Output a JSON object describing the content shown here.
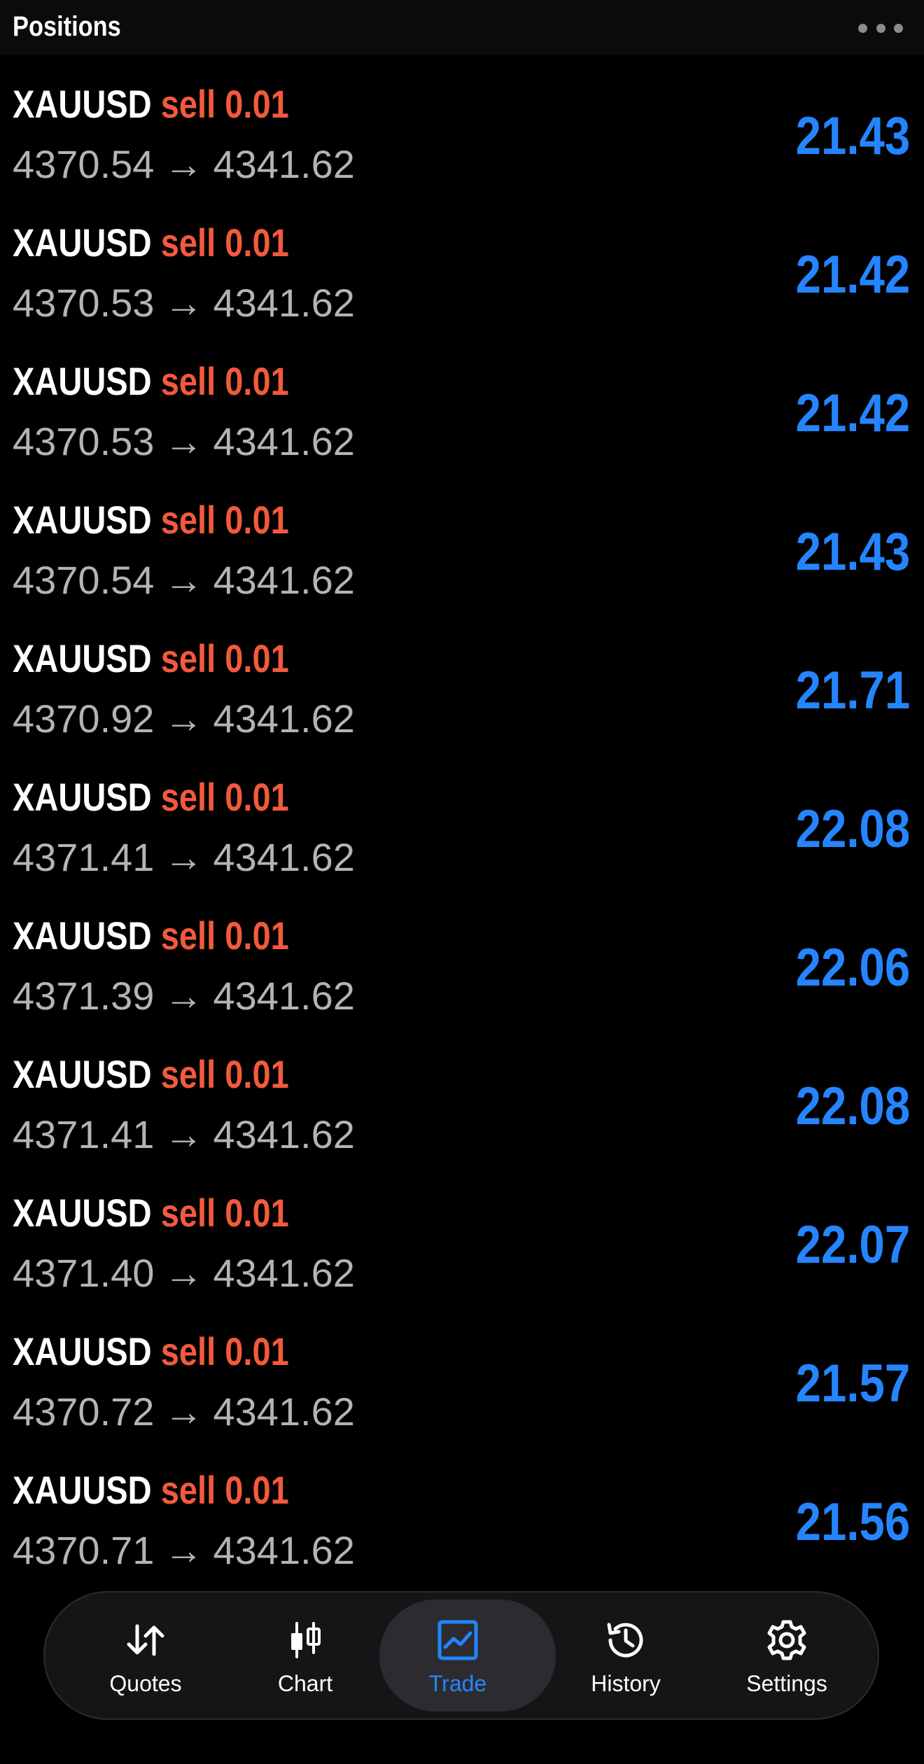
{
  "header": {
    "title": "Positions",
    "more_icon": "more-horizontal-icon"
  },
  "positions": [
    {
      "symbol": "XAUUSD",
      "side": "sell",
      "volume": "0.01",
      "open_price": "4370.54",
      "current_price": "4341.62",
      "profit": "21.43"
    },
    {
      "symbol": "XAUUSD",
      "side": "sell",
      "volume": "0.01",
      "open_price": "4370.53",
      "current_price": "4341.62",
      "profit": "21.42"
    },
    {
      "symbol": "XAUUSD",
      "side": "sell",
      "volume": "0.01",
      "open_price": "4370.53",
      "current_price": "4341.62",
      "profit": "21.42"
    },
    {
      "symbol": "XAUUSD",
      "side": "sell",
      "volume": "0.01",
      "open_price": "4370.54",
      "current_price": "4341.62",
      "profit": "21.43"
    },
    {
      "symbol": "XAUUSD",
      "side": "sell",
      "volume": "0.01",
      "open_price": "4370.92",
      "current_price": "4341.62",
      "profit": "21.71"
    },
    {
      "symbol": "XAUUSD",
      "side": "sell",
      "volume": "0.01",
      "open_price": "4371.41",
      "current_price": "4341.62",
      "profit": "22.08"
    },
    {
      "symbol": "XAUUSD",
      "side": "sell",
      "volume": "0.01",
      "open_price": "4371.39",
      "current_price": "4341.62",
      "profit": "22.06"
    },
    {
      "symbol": "XAUUSD",
      "side": "sell",
      "volume": "0.01",
      "open_price": "4371.41",
      "current_price": "4341.62",
      "profit": "22.08"
    },
    {
      "symbol": "XAUUSD",
      "side": "sell",
      "volume": "0.01",
      "open_price": "4371.40",
      "current_price": "4341.62",
      "profit": "22.07"
    },
    {
      "symbol": "XAUUSD",
      "side": "sell",
      "volume": "0.01",
      "open_price": "4370.72",
      "current_price": "4341.62",
      "profit": "21.57"
    },
    {
      "symbol": "XAUUSD",
      "side": "sell",
      "volume": "0.01",
      "open_price": "4370.71",
      "current_price": "4341.62",
      "profit": "21.56"
    }
  ],
  "arrow": "→",
  "tab_bar": {
    "active": "trade",
    "tabs": [
      {
        "id": "quotes",
        "label": "Quotes",
        "icon": "sort-arrows-icon"
      },
      {
        "id": "chart",
        "label": "Chart",
        "icon": "candlestick-icon"
      },
      {
        "id": "trade",
        "label": "Trade",
        "icon": "trend-chart-icon"
      },
      {
        "id": "history",
        "label": "History",
        "icon": "history-clock-icon"
      },
      {
        "id": "settings",
        "label": "Settings",
        "icon": "gear-icon"
      }
    ]
  },
  "colors": {
    "background": "#000000",
    "sell": "#f25a3c",
    "profit": "#2585ff",
    "muted_text": "#b4b4b8",
    "accent": "#2585ff"
  }
}
